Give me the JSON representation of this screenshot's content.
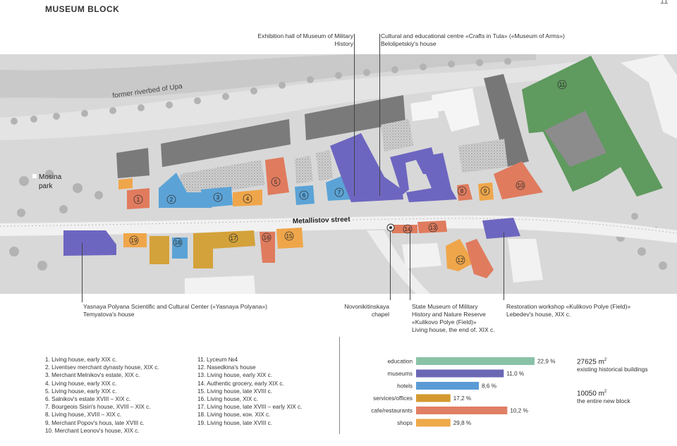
{
  "header": {
    "title": "MUSEUM BLOCK",
    "page_number": "11"
  },
  "map": {
    "labels": {
      "riverbed": "former riverbed of Upa",
      "park_line1": "Mosina",
      "park_line2": "park",
      "street": "Metallistov street"
    },
    "building_numbers": [
      "1",
      "2",
      "3",
      "4",
      "5",
      "6",
      "7",
      "8",
      "9",
      "10",
      "11",
      "12",
      "13",
      "14",
      "15",
      "16",
      "17",
      "18",
      "19"
    ]
  },
  "callouts": {
    "exhibition": [
      "Exhibition hall of Museum of Military",
      "History"
    ],
    "cultural": [
      "Cultural and educational centre «Crafts in Tula» («Museum of Arms»)",
      "Belolipetskiy's house"
    ],
    "yasnaya": [
      "Yasnaya Polyana Scientific and Cultural Center («Yasnaya Polyana»)",
      "Temyatova's house"
    ],
    "chapel": [
      "Novonikitinskaya",
      "chapel"
    ],
    "state_museum": [
      "State Museum of Military",
      "History and Nature Reserve",
      "«Kulikovo Polye (Field)»",
      "Living house, the end of. XIX c."
    ],
    "restoration": [
      "Restoration workshop «Kulikovo Polye (Field)»",
      "Lebedev's house, XIX c."
    ]
  },
  "legend": {
    "col1": [
      "1. Living house,  early XIX c.",
      "2. Liventsev merchant dynasty house, XIX c.",
      "3. Merchant Melnikov's estate, XIX c.",
      "4. Living house, early XIX c.",
      "5. Living house, early XIX c.",
      "6. Salnikov's estate  XVIII – XIX c.",
      "7. Bourgeois Sisin's house, XVIII – XIX c.",
      "8. Living house,  XVIII –  XIX c.",
      "9. Merchant Popov's hous, late XVIII c.",
      "10. Merchant Leonov's house,  XIX c."
    ],
    "col2": [
      "11. Lyceum №4",
      "12. Nasedkina's house",
      "13. Living house,  early  XIX c.",
      "14. Authentic grocery, early XIX c.",
      "15. Living house, late XVIII c.",
      "16. Living house, XIX c.",
      "17. Living house, late XVIII – early XIX c.",
      "18. Living house, кон. XIX c.",
      "19. Living house, late XVIII c."
    ]
  },
  "chart_data": {
    "type": "bar",
    "orientation": "horizontal",
    "categories": [
      "education",
      "museums",
      "hotels",
      "services/offices",
      "cafe/restaurants",
      "shops"
    ],
    "values": [
      22.9,
      11.0,
      8.6,
      17.2,
      10.2,
      29.8
    ],
    "value_labels": [
      "22,9 %",
      "11,0 %",
      "8,6 %",
      "17,2 %",
      "10,2 %",
      "29,8 %"
    ],
    "bar_lengths_relative": [
      1.0,
      0.74,
      0.53,
      0.29,
      0.77,
      0.29
    ],
    "colors": [
      "#8ac2a8",
      "#6c67b5",
      "#5b9bd5",
      "#d4992e",
      "#e07f64",
      "#eea94a"
    ],
    "title": "",
    "xlabel": "",
    "ylabel": ""
  },
  "stats": {
    "existing_value": "27625 m",
    "existing_unit": "2",
    "existing_label": "existing historical buildings",
    "new_value": "10050 m",
    "new_unit": "2",
    "new_label": "the entire new block"
  },
  "colors": {
    "museum": "#6d66c0",
    "education_green": "#5f9a5f",
    "cafe": "#e07b5e",
    "shop": "#efa64a",
    "hotel": "#5ba3d6",
    "services": "#d4a23a",
    "map_bg": "#d9d9d9",
    "road": "#f2f2f2"
  }
}
